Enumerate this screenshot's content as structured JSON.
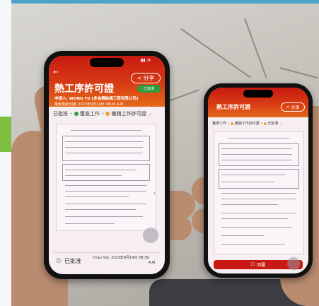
{
  "left_phone": {
    "status_time": "",
    "back_label": "←",
    "share_label": "分享",
    "badge_label": "已批准",
    "title": "熱工序許可證",
    "applicant": "申請人: WONG TO [多金鋼結構工程有限公司]",
    "updated": "最後更新日期: 2023年9月14日 08:40 A.M.",
    "flow_approved": "已批核",
    "flow_step1": "獲准工作",
    "flow_step2": "撤銷工作許可證",
    "footer_status": "已批准",
    "footer_signer": "Chan Yuk, 2023年9月14日 08:39",
    "footer_signer_time": "A.M."
  },
  "right_phone": {
    "title": "熱工序許可證",
    "share_label": "分享",
    "flow_step1": "獲准工作",
    "flow_step2": "撤銷工作許可證",
    "flow_step3": "已批准",
    "footer_button": "回覆"
  },
  "colors": {
    "header_red": "#c81a12",
    "header_orange": "#e56a1a",
    "approved_green": "#2e9e3e",
    "pending_orange": "#f0a030"
  }
}
